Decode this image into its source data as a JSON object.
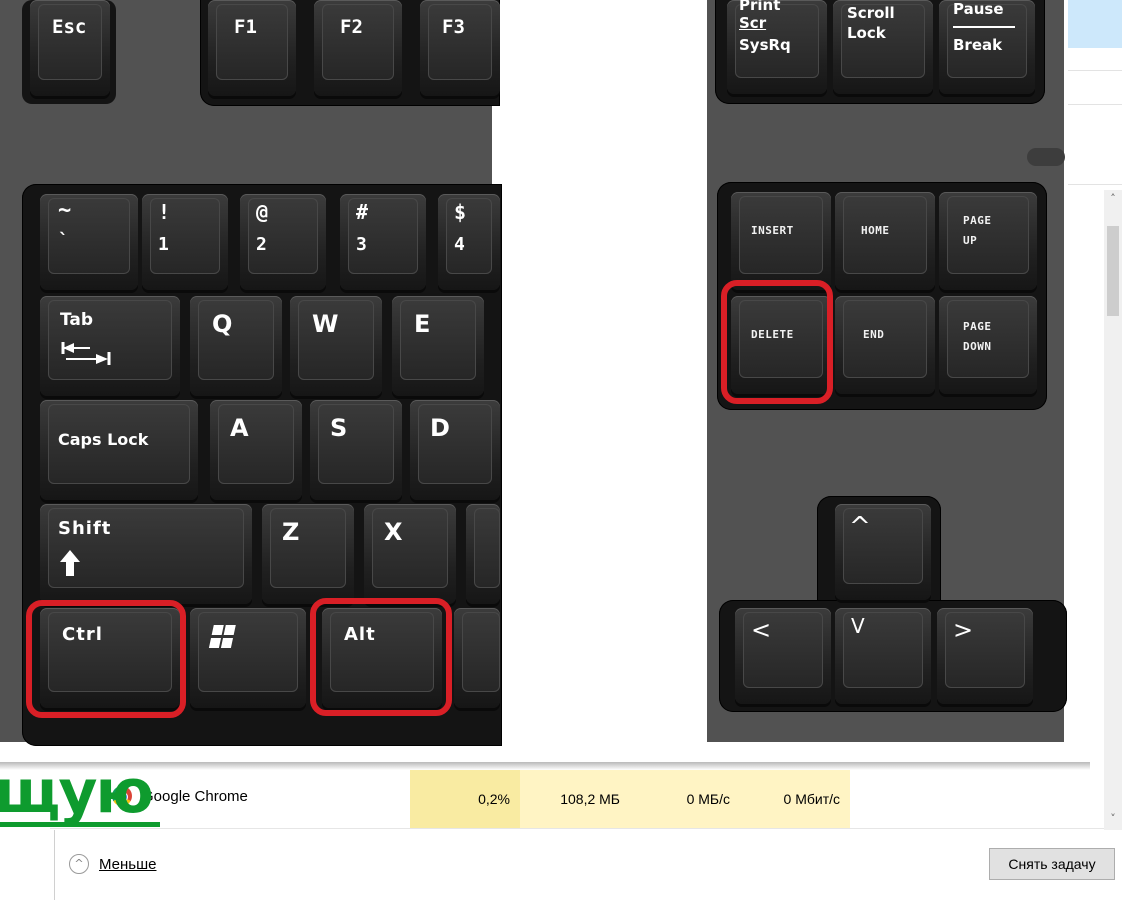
{
  "keyboard": {
    "function_row": {
      "esc": "Esc",
      "f1": "F1",
      "f2": "F2",
      "f3": "F3"
    },
    "system_keys": {
      "print_top": "Print",
      "print_mid": "Scr",
      "print_bottom": "SysRq",
      "scroll_top": "Scroll",
      "scroll_bottom": "Lock",
      "pause_top": "Pause",
      "pause_bottom": "Break"
    },
    "number_row": [
      {
        "top": "~",
        "bottom": "`"
      },
      {
        "top": "!",
        "bottom": "1"
      },
      {
        "top": "@",
        "bottom": "2"
      },
      {
        "top": "#",
        "bottom": "3"
      },
      {
        "top": "$",
        "bottom": "4"
      }
    ],
    "tab": "Tab",
    "letters_row1": [
      "Q",
      "W",
      "E"
    ],
    "caps_lock": "Caps Lock",
    "letters_row2": [
      "A",
      "S",
      "D"
    ],
    "shift": "Shift",
    "letters_row3": [
      "Z",
      "X"
    ],
    "ctrl": "Ctrl",
    "alt": "Alt",
    "nav_cluster": {
      "insert": "INSERT",
      "home": "HOME",
      "page_up_1": "PAGE",
      "page_up_2": "UP",
      "delete": "DELETE",
      "end": "END",
      "page_down_1": "PAGE",
      "page_down_2": "DOWN"
    },
    "arrows": {
      "up": "^",
      "left": "<",
      "down": "V",
      "right": ">"
    },
    "highlight_color": "#d91f26"
  },
  "overlay_text": "щую",
  "task_manager": {
    "process": {
      "name": "Google Chrome",
      "cpu": "0,2%",
      "memory": "108,2 МБ",
      "disk": "0 МБ/с",
      "network": "0 Мбит/с"
    },
    "less_label": "Меньше",
    "end_task_label": "Снять задачу"
  }
}
